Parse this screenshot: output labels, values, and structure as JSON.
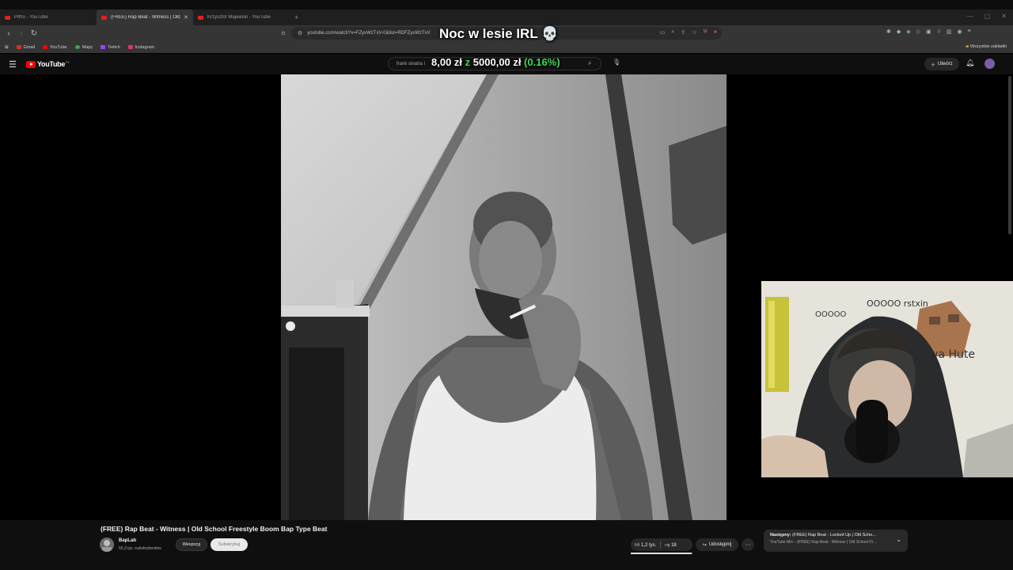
{
  "browser": {
    "tabs": [
      {
        "title": "Piffro - YouTube",
        "active": false
      },
      {
        "title": "(FREE) Rap Beat - Witness | Old S",
        "active": true
      },
      {
        "title": "Krzysztof Majewski - YouTube",
        "active": false
      }
    ],
    "new_tab": "+",
    "address": "youtube.com/watch?v=FZyvWzTxV-0&list=RDFZyvWzTxV",
    "bookmarks": [
      {
        "label": "Gmail",
        "color": "#d93025"
      },
      {
        "label": "YouTube",
        "color": "#ff0000"
      },
      {
        "label": "Mapy",
        "color": "#34a853"
      },
      {
        "label": "Twitch",
        "color": "#9146ff"
      },
      {
        "label": "Instagram",
        "color": "#e1306c"
      }
    ],
    "all_bookmarks": "Wszystkie zakładki"
  },
  "overlay": {
    "stream_title": "Noc w lesie IRL 💀",
    "donation_current": "8,00 zł",
    "donation_sep": "z",
    "donation_goal": "5000,00 zł",
    "donation_pct": "(0.16%)"
  },
  "youtube": {
    "logo": "YouTube",
    "logo_country": "PL",
    "search_value": "frank sinatra i",
    "create_label": "Utwórz"
  },
  "video": {
    "title": "(FREE) Rap Beat - Witness | Old School Freestyle Boom Bap Type Beat",
    "channel": "BapLab",
    "subscribers": "50,3 tys. subskrybentów",
    "support_label": "Wesprzyj",
    "subscribe_label": "Subskrybuj",
    "likes": "1,2 tys.",
    "dislikes": "18",
    "like_ratio": 0.985,
    "share_label": "Udostępnij",
    "more_label": "···"
  },
  "up_next": {
    "prefix": "Następny:",
    "title": "(FREE) Rap Beat - Locked Up | Old Scho...",
    "subtitle": "YouTube Mix – (FREE) Rap Beat - Witness | Old School Fr..."
  },
  "webcam_doodles": {
    "text1": "OOOOO rstxin",
    "text2": "Nowa Hute",
    "text3": "OOOOO"
  }
}
